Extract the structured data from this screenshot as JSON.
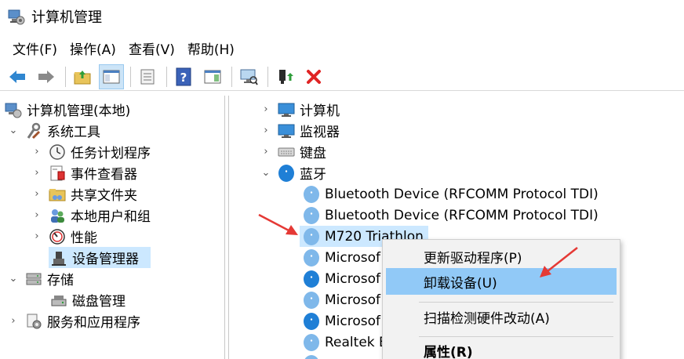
{
  "window": {
    "title": "计算机管理"
  },
  "menu": [
    "文件(F)",
    "操作(A)",
    "查看(V)",
    "帮助(H)"
  ],
  "left_tree": [
    {
      "label": "计算机管理(本地)",
      "icon": "computer-management-icon"
    },
    {
      "label": "系统工具",
      "icon": "tools-icon"
    },
    {
      "label": "任务计划程序",
      "icon": "clock-icon"
    },
    {
      "label": "事件查看器",
      "icon": "event-viewer-icon"
    },
    {
      "label": "共享文件夹",
      "icon": "shared-folder-icon"
    },
    {
      "label": "本地用户和组",
      "icon": "users-icon"
    },
    {
      "label": "性能",
      "icon": "performance-icon"
    },
    {
      "label": "设备管理器",
      "icon": "device-manager-icon"
    },
    {
      "label": "存储",
      "icon": "storage-icon"
    },
    {
      "label": "磁盘管理",
      "icon": "disk-icon"
    },
    {
      "label": "服务和应用程序",
      "icon": "services-icon"
    }
  ],
  "device_tree": [
    {
      "label": "计算机",
      "icon": "monitor-icon"
    },
    {
      "label": "监视器",
      "icon": "monitor-icon"
    },
    {
      "label": "键盘",
      "icon": "keyboard-icon"
    },
    {
      "label": "蓝牙",
      "icon": "bluetooth-icon"
    },
    {
      "label": "Bluetooth Device (RFCOMM Protocol TDI)",
      "icon": "bluetooth-icon"
    },
    {
      "label": "Bluetooth Device (RFCOMM Protocol TDI)",
      "icon": "bluetooth-icon"
    },
    {
      "label": "M720 Triathlon",
      "icon": "bluetooth-icon"
    },
    {
      "label": "Microsof",
      "icon": "bluetooth-icon"
    },
    {
      "label": "Microsof",
      "icon": "bluetooth-icon"
    },
    {
      "label": "Microsof",
      "icon": "bluetooth-icon"
    },
    {
      "label": "Microsof",
      "icon": "bluetooth-icon"
    },
    {
      "label": "Realtek B",
      "icon": "bluetooth-icon"
    }
  ],
  "context_menu": [
    "更新驱动程序(P)",
    "卸载设备(U)",
    "扫描检测硬件改动(A)",
    "属性(R)"
  ],
  "colors": {
    "selection": "#cce8ff",
    "menu_hover": "#91c9f7",
    "arrow": "#e53935",
    "bluetooth": "#1f7fd6"
  }
}
